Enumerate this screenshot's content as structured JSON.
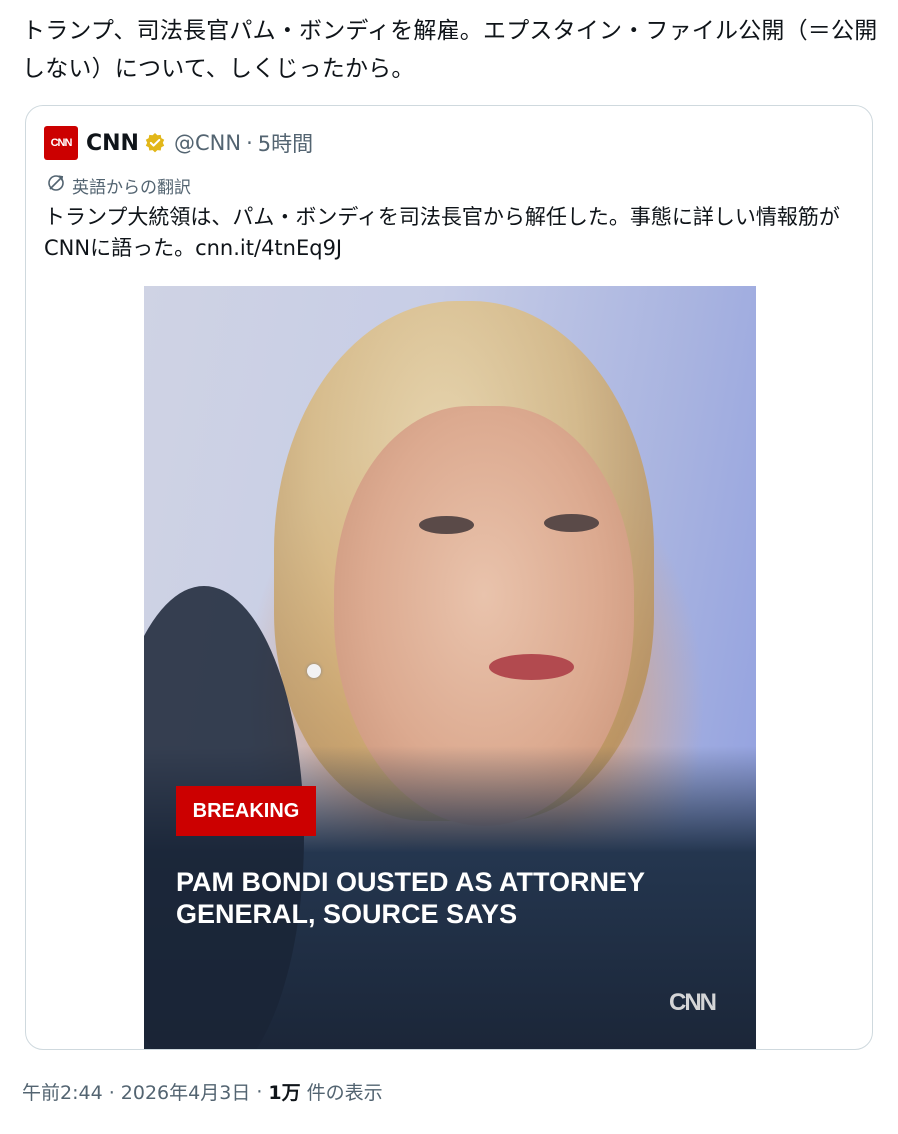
{
  "post": {
    "text": "トランプ、司法長官パム・ボンディを解雇。エプスタイン・ファイル公開（＝公開しない）について、しくじったから。"
  },
  "quote": {
    "logo_text": "CNN",
    "display_name": "CNN",
    "handle": "@CNN",
    "separator": "·",
    "time": "5時間",
    "verified_color": "#e2b719",
    "translate_label": "英語からの翻訳",
    "body": "トランプ大統領は、パム・ボンディを司法長官から解任した。事態に詳しい情報筋がCNNに語った。cnn.it/4tnEq9J",
    "media": {
      "badge": "BREAKING",
      "headline": "PAM BONDI OUSTED AS ATTORNEY GENERAL, SOURCE SAYS",
      "watermark": "CNN"
    }
  },
  "meta": {
    "datetime": "午前2:44 · 2026年4月3日",
    "dot": "·",
    "views_count": "1万",
    "views_label": "件の表示"
  },
  "colors": {
    "brand_red": "#cc0000",
    "text_secondary": "#536471",
    "border": "#cfd9de"
  }
}
